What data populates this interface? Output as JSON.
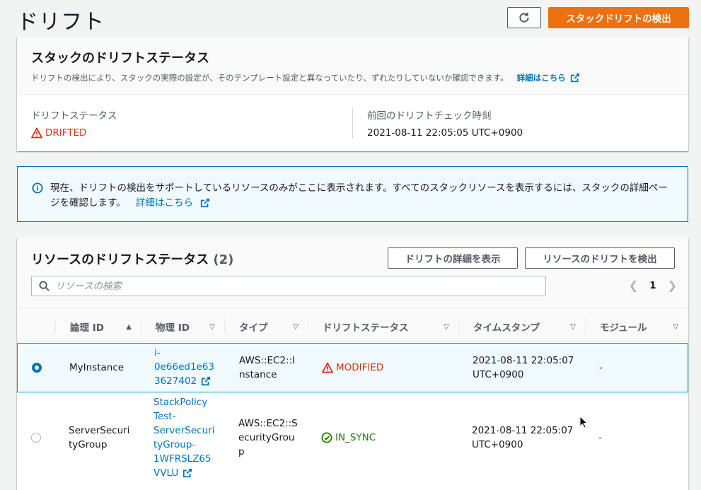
{
  "header": {
    "title": "ドリフト",
    "detect_button": "スタックドリフトの検出"
  },
  "stack_status": {
    "title": "スタックのドリフトステータス",
    "description": "ドリフトの検出により、スタックの実際の設定が、そのテンプレート設定と異なっていたり、ずれたりしていないか確認できます。",
    "learn_more": "詳細はこちら",
    "drift_status_label": "ドリフトステータス",
    "drift_status_value": "DRIFTED",
    "last_check_label": "前回のドリフトチェック時刻",
    "last_check_value": "2021-08-11 22:05:05 UTC+0900"
  },
  "info_banner": {
    "text": "現在、ドリフトの検出をサポートしているリソースのみがここに表示されます。すべてのスタックリソースを表示するには、スタックの詳細ページを確認します。",
    "link": "詳細はこちら"
  },
  "resources": {
    "title": "リソースのドリフトステータス",
    "count": "(2)",
    "view_details_button": "ドリフトの詳細を表示",
    "detect_resource_button": "リソースのドリフトを検出",
    "search_placeholder": "リソースの検索",
    "page": "1",
    "columns": {
      "logical_id": "論理 ID",
      "physical_id": "物理 ID",
      "type": "タイプ",
      "drift_status": "ドリフトステータス",
      "timestamp": "タイムスタンプ",
      "module": "モジュール"
    },
    "rows": [
      {
        "logical_id": "MyInstance",
        "physical_id": [
          "i-",
          "0e66ed1e63",
          "3627402"
        ],
        "type": [
          "AWS::EC2::I",
          "nstance"
        ],
        "drift_status": "MODIFIED",
        "timestamp": [
          "2021-08-11 22:05:07",
          "UTC+0900"
        ],
        "module": "-",
        "selected": true
      },
      {
        "logical_id": [
          "ServerSecuri",
          "tyGroup"
        ],
        "physical_id": [
          "StackPolicy",
          "Test-",
          "ServerSecuri",
          "tyGroup-",
          "1WFRSLZ65",
          "VVLU"
        ],
        "type": [
          "AWS::EC2::S",
          "ecurityGrou",
          "p"
        ],
        "drift_status": "IN_SYNC",
        "timestamp": [
          "2021-08-11 22:05:07",
          "UTC+0900"
        ],
        "module": "-",
        "selected": false
      }
    ]
  },
  "colors": {
    "primary": "#ec7211",
    "link": "#0073bb",
    "drifted": "#d13212",
    "in_sync": "#1d8102"
  }
}
